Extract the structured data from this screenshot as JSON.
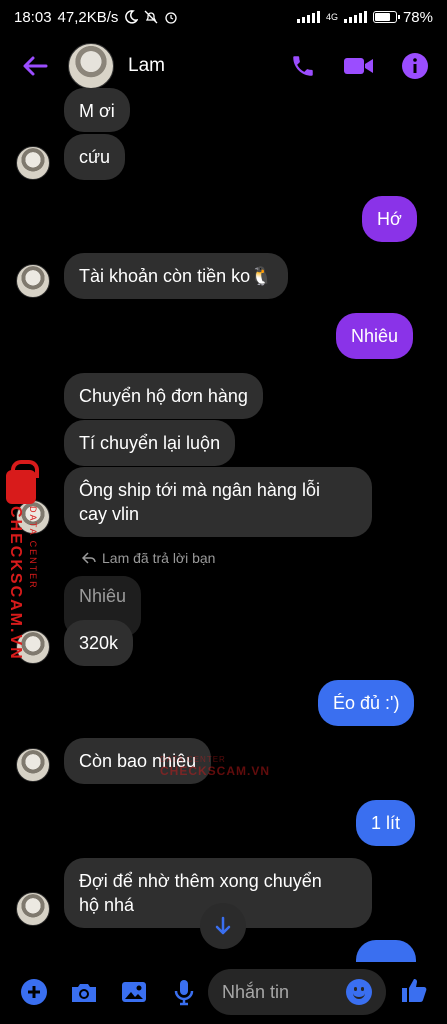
{
  "status_bar": {
    "time": "18:03",
    "net_speed": "47,2KB/s",
    "network": "4G",
    "battery": "78%",
    "battery_level": 0.78
  },
  "header": {
    "contact_name": "Lam",
    "accent": "#9b4dff"
  },
  "messages": [
    {
      "from": "them",
      "text": "M ơi"
    },
    {
      "from": "them",
      "text": "cứu"
    },
    {
      "from": "me",
      "text": "Hớ",
      "color": "#8a33e8"
    },
    {
      "from": "them",
      "text": "Tài khoản còn tiền ko🐧"
    },
    {
      "from": "me",
      "text": "Nhiêu",
      "color": "#8a33e8"
    },
    {
      "from": "them",
      "text": "Chuyển hộ đơn hàng"
    },
    {
      "from": "them",
      "text": "Tí chuyển lại luộn"
    },
    {
      "from": "them",
      "text_line1": "Ông ship tới mà ngân hàng lỗi",
      "text_line2": "cay vlin"
    },
    {
      "from": "them",
      "reply_note": "Lam đã trả lời bạn",
      "quoted": "Nhiêu",
      "text": "320k"
    },
    {
      "from": "me",
      "text": "Éo đủ :')",
      "color": "#3a6ff0"
    },
    {
      "from": "them",
      "text": "Còn bao nhiêu"
    },
    {
      "from": "me",
      "text": "1 lít",
      "color": "#3a6ff0"
    },
    {
      "from": "them",
      "text_line1": "Đợi để nhờ thêm xong chuyển",
      "text_line2": "hộ nhá"
    }
  ],
  "watermark": {
    "brand": "CHECKSCAM.VN",
    "sub": "DATA CENTER",
    "color": "#d81b1b"
  },
  "composer": {
    "placeholder": "Nhắn tin"
  }
}
